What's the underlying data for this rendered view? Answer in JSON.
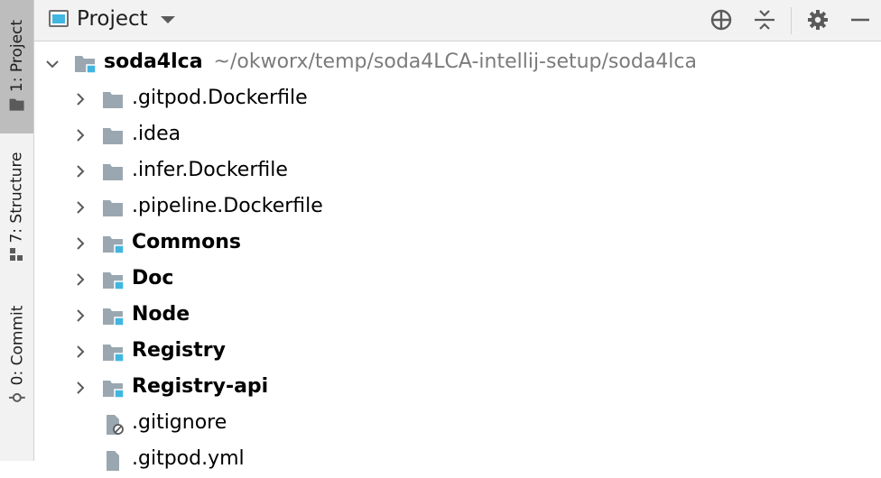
{
  "toolwindow_strip": {
    "tabs": [
      {
        "key": "1",
        "label": "1: Project",
        "active": true
      },
      {
        "key": "7",
        "label": "7: Structure",
        "active": false
      },
      {
        "key": "0",
        "label": "0: Commit",
        "active": false
      }
    ]
  },
  "header": {
    "title": "Project"
  },
  "tree": {
    "root": {
      "name": "soda4lca",
      "path": "~/okworx/temp/soda4LCA-intellij-setup/soda4lca"
    },
    "items": [
      {
        "name": ".gitpod.Dockerfile",
        "type": "folder",
        "bold": false
      },
      {
        "name": ".idea",
        "type": "folder",
        "bold": false
      },
      {
        "name": ".infer.Dockerfile",
        "type": "folder",
        "bold": false
      },
      {
        "name": ".pipeline.Dockerfile",
        "type": "folder",
        "bold": false
      },
      {
        "name": "Commons",
        "type": "module",
        "bold": true
      },
      {
        "name": "Doc",
        "type": "module",
        "bold": true
      },
      {
        "name": "Node",
        "type": "module",
        "bold": true
      },
      {
        "name": "Registry",
        "type": "module",
        "bold": true
      },
      {
        "name": "Registry-api",
        "type": "module",
        "bold": true
      },
      {
        "name": ".gitignore",
        "type": "ignored-file",
        "bold": false
      },
      {
        "name": ".gitpod.yml",
        "type": "file",
        "bold": false
      }
    ]
  },
  "colors": {
    "strip_bg": "#f2f2f2",
    "active_tab": "#bdbdbd",
    "folder": "#9aa7b0",
    "module_marker": "#40b6e0",
    "path_text": "#7b7b7b"
  }
}
